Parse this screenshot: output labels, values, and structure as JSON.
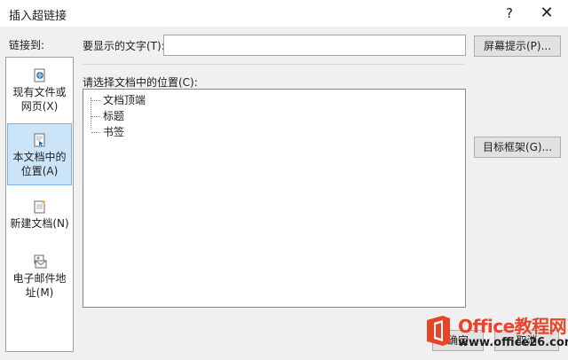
{
  "dialog": {
    "title": "插入超链接",
    "help_label": "?",
    "close_label": "✕"
  },
  "sidebar": {
    "label": "链接到:",
    "items": [
      {
        "label": "现有文件或网页(X)",
        "icon": "web-page-icon",
        "selected": false
      },
      {
        "label": "本文档中的位置(A)",
        "icon": "document-place-icon",
        "selected": true
      },
      {
        "label": "新建文档(N)",
        "icon": "new-document-icon",
        "selected": false
      },
      {
        "label": "电子邮件地址(M)",
        "icon": "email-icon",
        "selected": false
      }
    ]
  },
  "display": {
    "label": "要显示的文字(T):",
    "value": ""
  },
  "buttons": {
    "screentip": "屏幕提示(P)...",
    "target_frame": "目标框架(G)...",
    "ok": "确定",
    "cancel": "取消"
  },
  "place": {
    "label": "请选择文档中的位置(C):",
    "tree": [
      "文档顶端",
      "标题",
      "书签"
    ]
  },
  "watermark": {
    "title": "Office教程网",
    "url": "www.office26.com"
  }
}
